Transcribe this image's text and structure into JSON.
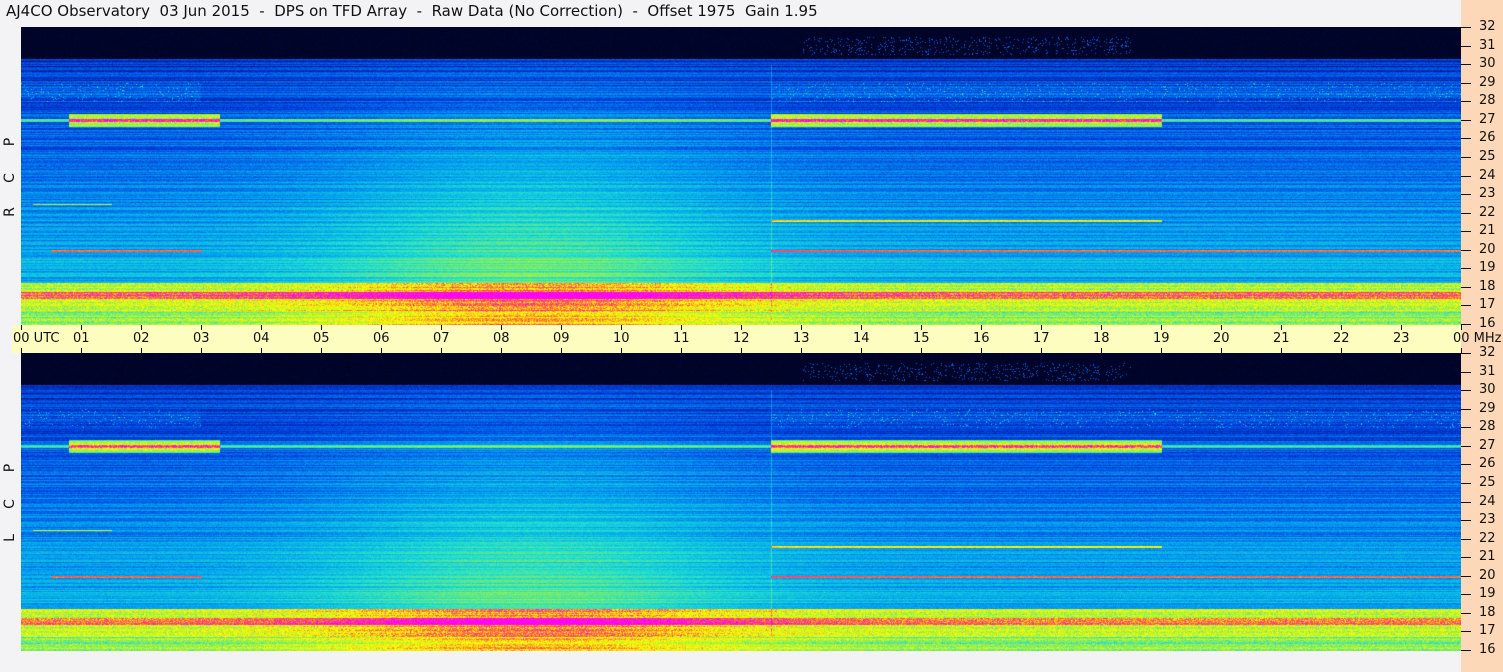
{
  "title": "AJ4CO Observatory  03 Jun 2015  -  DPS on TFD Array  -  Raw Data (No Correction)  -  Offset 1975  Gain 1.95",
  "panels": [
    {
      "name": "RCP",
      "letters": [
        "R",
        "C",
        "P"
      ]
    },
    {
      "name": "LCP",
      "letters": [
        "L",
        "C",
        "P"
      ]
    }
  ],
  "chart_data": {
    "type": "heatmap",
    "title": "AJ4CO Observatory 03 Jun 2015 - DPS on TFD Array - Raw Data (No Correction) - Offset 1975 Gain 1.95",
    "xlabel": "UTC",
    "ylabel": "MHz",
    "xlim": [
      0,
      24
    ],
    "ylim": [
      16,
      32
    ],
    "x_ticks": [
      "00",
      "01",
      "02",
      "03",
      "04",
      "05",
      "06",
      "07",
      "08",
      "09",
      "10",
      "11",
      "12",
      "13",
      "14",
      "15",
      "16",
      "17",
      "18",
      "19",
      "20",
      "21",
      "22",
      "23",
      "00"
    ],
    "x_first_suffix": "UTC",
    "x_last_suffix": "MHz",
    "y_ticks": [
      32,
      31,
      30,
      29,
      28,
      27,
      26,
      25,
      24,
      23,
      22,
      21,
      20,
      19,
      18,
      17,
      16
    ],
    "colormap": [
      "#000010",
      "#00106a",
      "#0040e0",
      "#00a0f0",
      "#20e0d0",
      "#a0f040",
      "#ffff00",
      "#ff6040",
      "#ff00ff"
    ],
    "features": [
      {
        "freq_mhz": 27,
        "hours": [
          [
            1,
            3.3
          ],
          [
            12.5,
            19
          ]
        ],
        "strength": "strong"
      },
      {
        "freq_mhz": 17.6,
        "hours": [
          [
            0,
            24
          ]
        ],
        "strength": "strong"
      },
      {
        "freq_mhz": 20,
        "hours": [
          [
            0.5,
            3
          ],
          [
            12.5,
            24
          ]
        ],
        "strength": "narrow"
      },
      {
        "freq_mhz": 21.5,
        "hours": [
          [
            12.5,
            19
          ]
        ],
        "strength": "narrow"
      }
    ]
  }
}
